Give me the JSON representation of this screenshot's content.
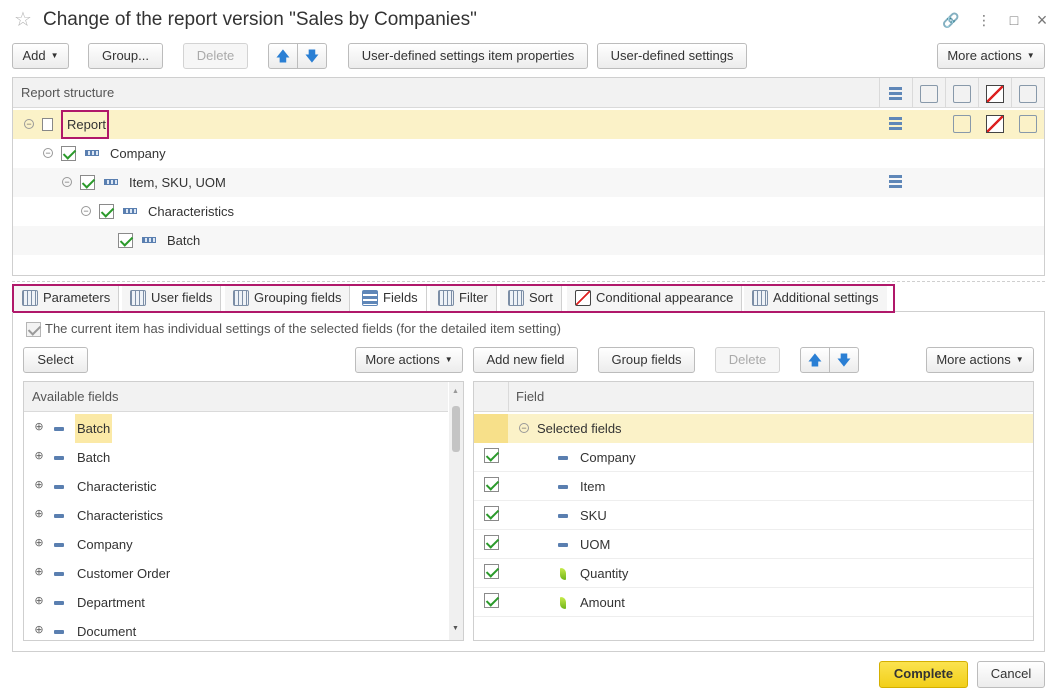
{
  "window": {
    "title": "Change of the report version \"Sales by Companies\"",
    "star_icon": "☆",
    "link_icon": "🔗",
    "menu_icon": "⋮",
    "maximize_icon": "□",
    "close_icon": "×"
  },
  "toolbar": {
    "add": "Add",
    "group": "Group...",
    "delete": "Delete",
    "up": "🡅",
    "down": "🡇",
    "item_properties": "User-defined settings item properties",
    "user_settings": "User-defined settings",
    "more_actions": "More actions"
  },
  "structure": {
    "header": "Report structure",
    "rows": [
      {
        "label": "Report"
      },
      {
        "label": "Company"
      },
      {
        "label": "Item, SKU, UOM"
      },
      {
        "label": "Characteristics"
      },
      {
        "label": "Batch"
      }
    ]
  },
  "tabs": [
    {
      "label": "Parameters"
    },
    {
      "label": "User fields"
    },
    {
      "label": "Grouping fields"
    },
    {
      "label": "Fields"
    },
    {
      "label": "Filter"
    },
    {
      "label": "Sort"
    },
    {
      "label": "Conditional appearance"
    },
    {
      "label": "Additional settings"
    }
  ],
  "fields_tab": {
    "individual_settings_label": "The current item has individual settings of the selected fields (for the detailed item setting)",
    "select_button": "Select",
    "more_actions_left": "More actions",
    "add_new_field": "Add new field",
    "group_fields": "Group fields",
    "delete": "Delete",
    "more_actions_right": "More actions",
    "available_header": "Available fields",
    "available_fields": [
      {
        "label": "Batch"
      },
      {
        "label": "Batch"
      },
      {
        "label": "Characteristic"
      },
      {
        "label": "Characteristics"
      },
      {
        "label": "Company"
      },
      {
        "label": "Customer Order"
      },
      {
        "label": "Department"
      },
      {
        "label": "Document"
      }
    ],
    "field_header": "Field",
    "selected_group": "Selected fields",
    "selected_fields": [
      {
        "label": "Company"
      },
      {
        "label": "Item"
      },
      {
        "label": "SKU"
      },
      {
        "label": "UOM"
      },
      {
        "label": "Quantity"
      },
      {
        "label": "Amount"
      }
    ]
  },
  "footer": {
    "complete": "Complete",
    "cancel": "Cancel"
  },
  "colors": {
    "selected_row": "#fbf2c8",
    "highlight_border": "#b0186a",
    "primary_button": "#f2cf1a",
    "check_green": "#2b9a2b"
  }
}
